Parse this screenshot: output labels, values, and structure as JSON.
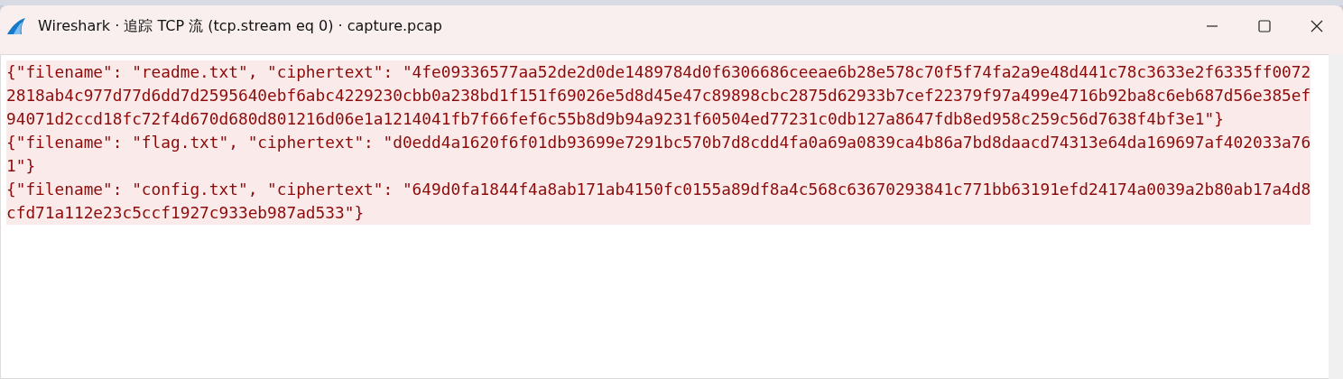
{
  "window": {
    "title": "Wireshark · 追踪 TCP 流 (tcp.stream eq 0) · capture.pcap"
  },
  "stream": [
    {
      "text": "{\"filename\": \"readme.txt\", \"ciphertext\": \"4fe09336577aa52de2d0de1489784d0f6306686ceeae6b28e578c70f5f74fa2a9e48d441c78c3633e2f6335ff00722818ab4c977d77d6dd7d2595640ebf6abc4229230cbb0a238bd1f151f69026e5d8d45e47c89898cbc2875d62933b7cef22379f97a499e4716b92ba8c6eb687d56e385ef94071d2ccd18fc72f4d670d680d801216d06e1a1214041fb7f66fef6c55b8d9b94a9231f60504ed77231c0db127a8647fdb8ed958c259c56d7638f4bf3e1\"}"
    },
    {
      "text": "{\"filename\": \"flag.txt\", \"ciphertext\": \"d0edd4a1620f6f01db93699e7291bc570b7d8cdd4fa0a69a0839ca4b86a7bd8daacd74313e64da169697af402033a761\"}"
    },
    {
      "text": "{\"filename\": \"config.txt\", \"ciphertext\": \"649d0fa1844f4a8ab171ab4150fc0155a89df8a4c568c63670293841c771bb63191efd24174a0039a2b80ab17a4d8cfd71a112e23c5ccf1927c933eb987ad533\"}"
    }
  ]
}
